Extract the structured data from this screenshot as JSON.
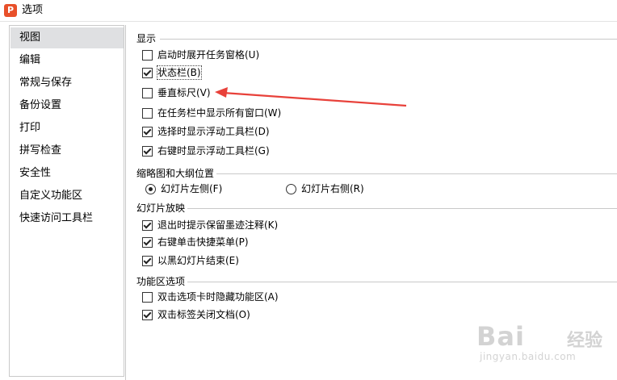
{
  "window": {
    "title": "选项",
    "app_icon_letter": "P"
  },
  "sidebar": {
    "items": [
      {
        "label": "视图",
        "selected": true
      },
      {
        "label": "编辑"
      },
      {
        "label": "常规与保存"
      },
      {
        "label": "备份设置"
      },
      {
        "label": "打印"
      },
      {
        "label": "拼写检查"
      },
      {
        "label": "安全性"
      },
      {
        "label": "自定义功能区"
      },
      {
        "label": "快速访问工具栏"
      }
    ]
  },
  "display": {
    "title": "显示",
    "options": [
      {
        "label": "启动时展开任务窗格(U)",
        "checked": false
      },
      {
        "label": "状态栏(B)",
        "checked": true
      },
      {
        "label": "垂直标尺(V)",
        "checked": false
      },
      {
        "label": "在任务栏中显示所有窗口(W)",
        "checked": false
      },
      {
        "label": "选择时显示浮动工具栏(D)",
        "checked": true
      },
      {
        "label": "右键时显示浮动工具栏(G)",
        "checked": true
      }
    ]
  },
  "thumbnail": {
    "title": "缩略图和大纲位置",
    "left_label": "幻灯片左侧(F)",
    "right_label": "幻灯片右侧(R)",
    "selected": "left"
  },
  "slideshow": {
    "title": "幻灯片放映",
    "options": [
      {
        "label": "退出时提示保留墨迹注释(K)",
        "checked": true
      },
      {
        "label": "右键单击快捷菜单(P)",
        "checked": true
      },
      {
        "label": "以黑幻灯片结束(E)",
        "checked": true
      }
    ]
  },
  "ribbon": {
    "title": "功能区选项",
    "options": [
      {
        "label": "双击选项卡时隐藏功能区(A)",
        "checked": false
      },
      {
        "label": "双击标签关闭文档(O)",
        "checked": true
      }
    ]
  },
  "watermark": {
    "logo": "Bai",
    "logo2": "经验",
    "url": "jingyan.baidu.com"
  },
  "colors": {
    "arrow": "#e8413a",
    "selected_bg": "#dfe0e2",
    "app_icon": "#e8502a"
  }
}
